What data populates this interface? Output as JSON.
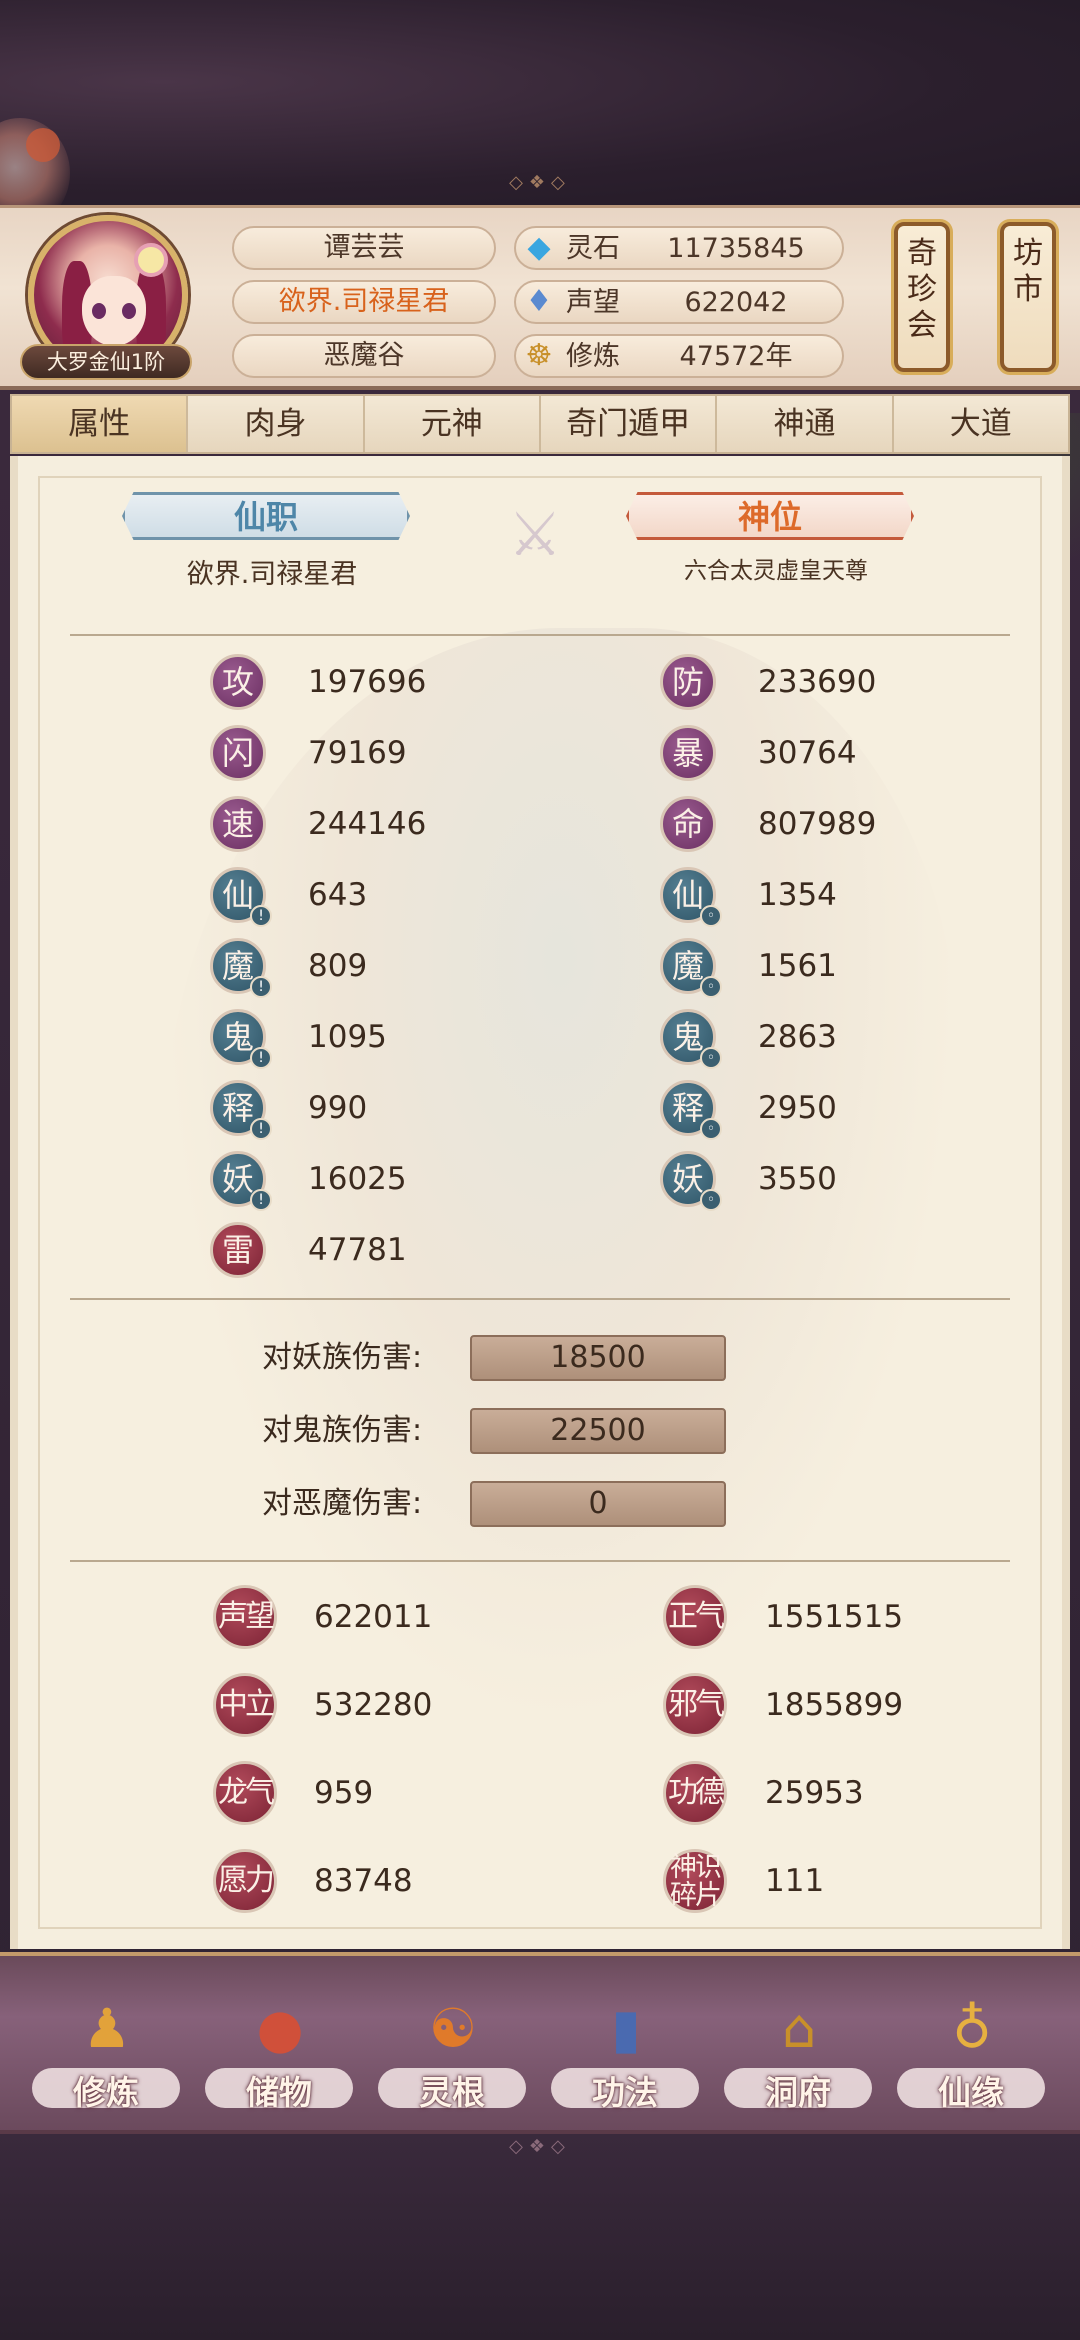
{
  "player": {
    "name": "谭芸芸",
    "title": "欲界.司禄星君",
    "sect": "恶魔谷",
    "rank": "大罗金仙1阶"
  },
  "resources": [
    {
      "icon": "spirit-stone-icon",
      "label": "灵石",
      "value": "11735845"
    },
    {
      "icon": "prestige-icon",
      "label": "声望",
      "value": "622042"
    },
    {
      "icon": "cultivation-icon",
      "label": "修炼",
      "value": "47572年"
    }
  ],
  "side_buttons": {
    "treasure_fair": "奇珍会",
    "market": "坊市"
  },
  "tabs": [
    "属性",
    "肉身",
    "元神",
    "奇门遁甲",
    "神通",
    "大道"
  ],
  "active_tab": "属性",
  "positions": {
    "immortal_post_label": "仙职",
    "immortal_post_value": "欲界.司禄星君",
    "divine_seat_label": "神位",
    "divine_seat_value": "六合太灵虚皇天尊"
  },
  "stats_left": [
    {
      "glyph": "攻",
      "value": "197696",
      "color": "purple"
    },
    {
      "glyph": "闪",
      "value": "79169",
      "color": "purple"
    },
    {
      "glyph": "速",
      "value": "244146",
      "color": "purple"
    },
    {
      "glyph": "仙",
      "value": "643",
      "color": "teal"
    },
    {
      "glyph": "魔",
      "value": "809",
      "color": "teal"
    },
    {
      "glyph": "鬼",
      "value": "1095",
      "color": "teal"
    },
    {
      "glyph": "释",
      "value": "990",
      "color": "teal"
    },
    {
      "glyph": "妖",
      "value": "16025",
      "color": "teal"
    },
    {
      "glyph": "雷",
      "value": "47781",
      "color": "red"
    }
  ],
  "stats_right": [
    {
      "glyph": "防",
      "value": "233690",
      "color": "purple"
    },
    {
      "glyph": "暴",
      "value": "30764",
      "color": "purple"
    },
    {
      "glyph": "命",
      "value": "807989",
      "color": "purple"
    },
    {
      "glyph": "仙",
      "value": "1354",
      "color": "teal"
    },
    {
      "glyph": "魔",
      "value": "1561",
      "color": "teal"
    },
    {
      "glyph": "鬼",
      "value": "2863",
      "color": "teal"
    },
    {
      "glyph": "释",
      "value": "2950",
      "color": "teal"
    },
    {
      "glyph": "妖",
      "value": "3550",
      "color": "teal"
    }
  ],
  "damage": [
    {
      "label": "对妖族伤害:",
      "value": "18500"
    },
    {
      "label": "对鬼族伤害:",
      "value": "22500"
    },
    {
      "label": "对恶魔伤害:",
      "value": "0"
    }
  ],
  "reputation_left": [
    {
      "glyph": "声望",
      "value": "622011"
    },
    {
      "glyph": "中立",
      "value": "532280"
    },
    {
      "glyph": "龙气",
      "value": "959"
    },
    {
      "glyph": "愿力",
      "value": "83748"
    }
  ],
  "reputation_right": [
    {
      "glyph": "正气",
      "value": "1551515"
    },
    {
      "glyph": "邪气",
      "value": "1855899"
    },
    {
      "glyph": "功德",
      "value": "25953"
    },
    {
      "glyph": "神识碎片",
      "value": "111"
    }
  ],
  "bottom_nav": [
    {
      "icon": "cultivation-figure-icon",
      "label": "修炼"
    },
    {
      "icon": "storage-bag-icon",
      "label": "储物"
    },
    {
      "icon": "spirit-root-icon",
      "label": "灵根"
    },
    {
      "icon": "technique-book-icon",
      "label": "功法"
    },
    {
      "icon": "cave-dwelling-icon",
      "label": "洞府"
    },
    {
      "icon": "gourd-icon",
      "label": "仙缘"
    }
  ],
  "colors": {
    "accent_orange": "#d8621c",
    "immortal_blue": "#4e86a8",
    "divine_red": "#dd6a2a",
    "panel_bg": "#f6efdf"
  }
}
